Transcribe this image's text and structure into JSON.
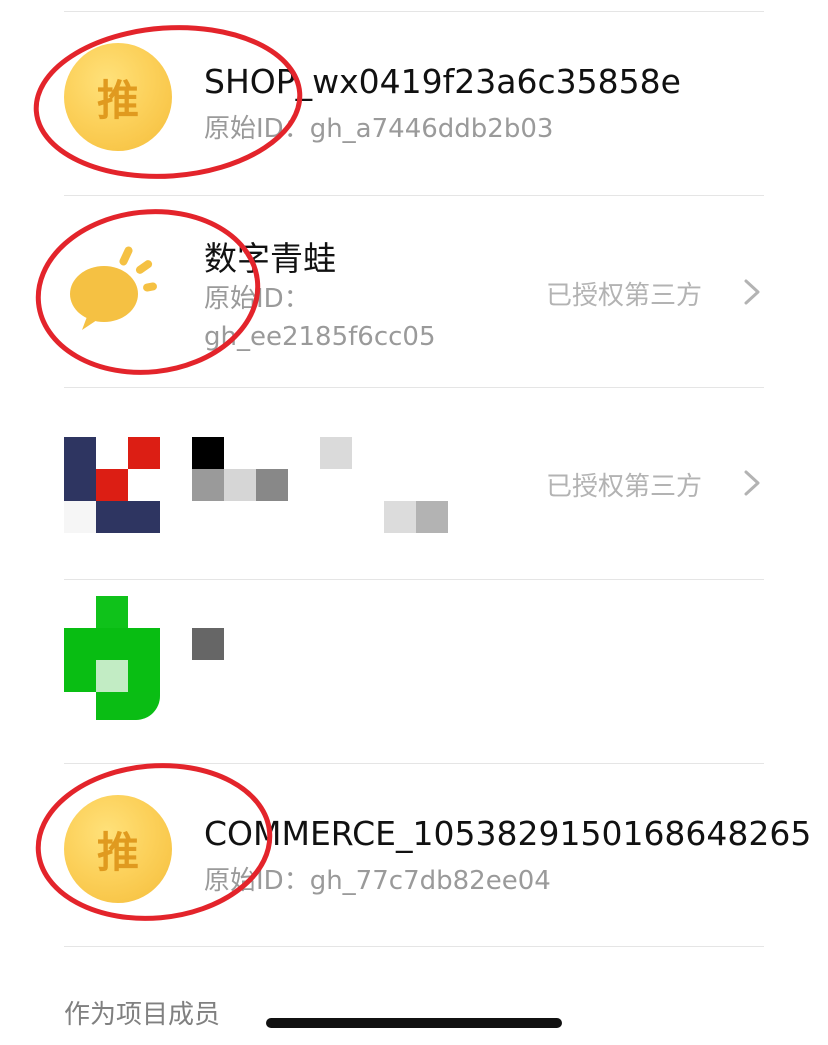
{
  "accounts": [
    {
      "avatar_char": "推",
      "name": "SHOP_wx0419f23a6c35858e",
      "id_label": "原始ID：",
      "id_value": "gh_a7446ddb2b03"
    },
    {
      "name": "数字青蛙",
      "id_label": "原始ID：",
      "id_value": "gh_ee2185f6cc05",
      "status": "已授权第三方"
    },
    {
      "status": "已授权第三方"
    },
    {},
    {
      "avatar_char": "推",
      "name": "COMMERCE_1053829150168648265",
      "id_label": "原始ID：",
      "id_value": "gh_77c7db82ee04"
    }
  ],
  "section_label": "作为项目成员",
  "colors": {
    "annotation_ring": "#e3242b",
    "avatar_gold": "#fcd15b",
    "avatar_char": "#e09a1f",
    "status_gray": "#b3b3b3",
    "divider": "#e5e5e5"
  },
  "icons": [
    "chevron-right-icon",
    "speech-bubble-icon",
    "pixelated-avatar"
  ]
}
